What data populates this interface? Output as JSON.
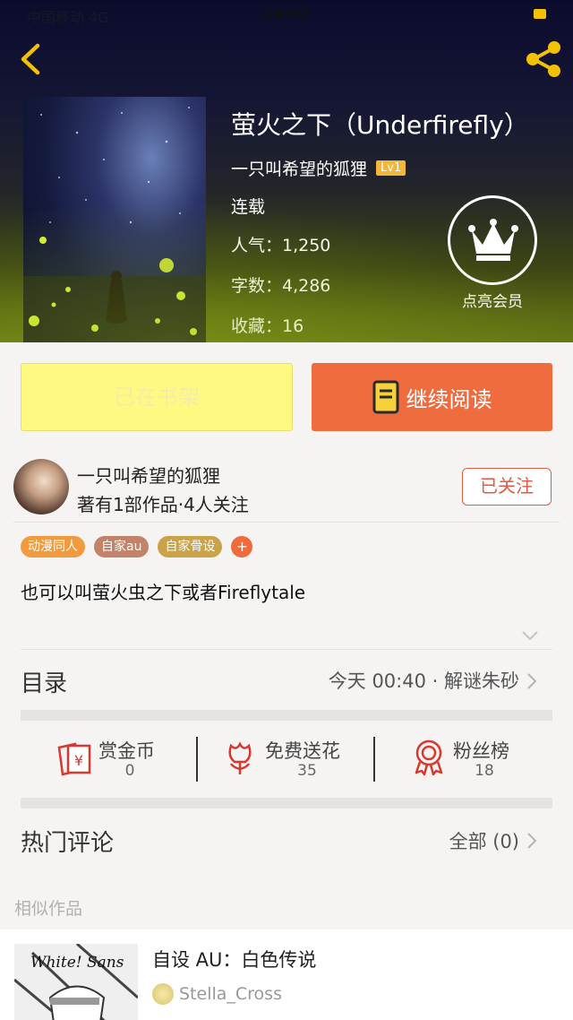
{
  "status": {
    "time": "20:07",
    "carrier": "中国移动 4G"
  },
  "book": {
    "title": "萤火之下（Underfirefly）",
    "author": "一只叫希望的狐狸",
    "level": "Lv1",
    "status": "连载",
    "popularity": "人气：1,250",
    "word_count": "字数：4,286",
    "favorites": "收藏：16"
  },
  "membership": {
    "label": "点亮会员"
  },
  "actions": {
    "shelf_label": "已在书架",
    "read_label": "继续阅读"
  },
  "author_info": {
    "name": "一只叫希望的狐狸",
    "sub": "著有1部作品·4人关注",
    "follow_label": "已关注"
  },
  "tags": [
    {
      "label": "动漫同人",
      "color": "#f29b3e"
    },
    {
      "label": "自家au",
      "color": "#c3826a"
    },
    {
      "label": "自家骨设",
      "color": "#c9a24a"
    }
  ],
  "tag_more": "+",
  "description": "也可以叫萤火虫之下或者Fireflytale",
  "catalog": {
    "label": "目录",
    "latest": "今天 00:40 · 解谜朱砂"
  },
  "stats": [
    {
      "label": "赏金币",
      "value": "0",
      "icon": "red-envelope-icon"
    },
    {
      "label": "免费送花",
      "value": "35",
      "icon": "flower-icon"
    },
    {
      "label": "粉丝榜",
      "value": "18",
      "icon": "medal-icon"
    }
  ],
  "comments": {
    "label": "热门评论",
    "all_label": "全部 (0)"
  },
  "similar": {
    "label": "相似作品",
    "items": [
      {
        "title": "自设 AU：白色传说",
        "author": "Stella_Cross",
        "thumb_text": "White! Sans"
      }
    ]
  },
  "colors": {
    "accent": "#ef6c3f",
    "shelf": "#fff982",
    "follow": "#e05a45",
    "stat_red": "#d9382f"
  }
}
